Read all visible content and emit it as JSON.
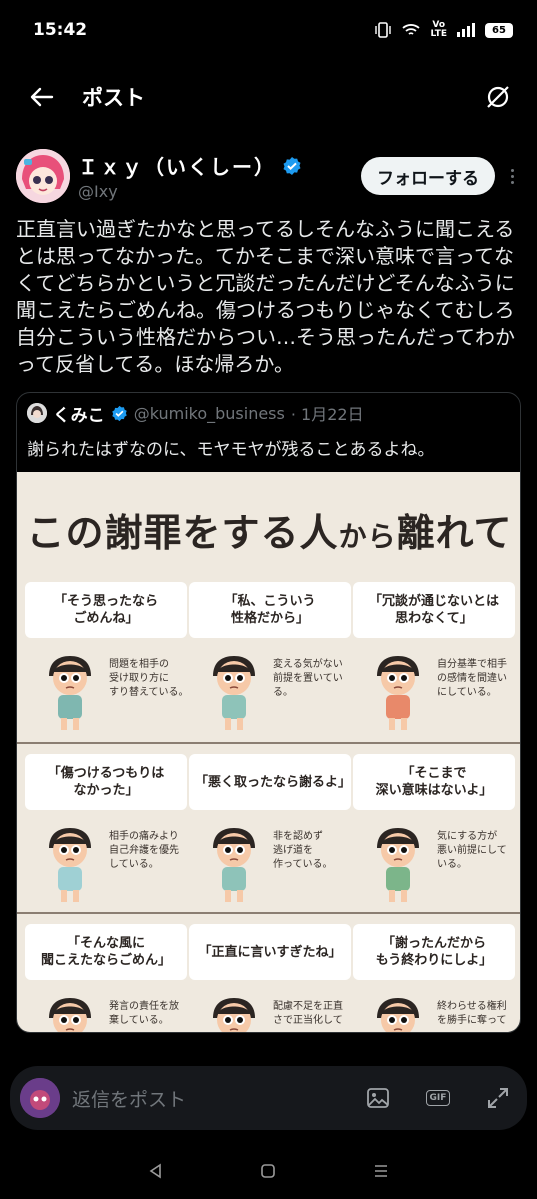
{
  "status_bar": {
    "time": "15:42",
    "volte_top": "Vo",
    "volte_bottom": "LTE",
    "battery": "65"
  },
  "header": {
    "title": "ポスト"
  },
  "post": {
    "author_name": "Ｉｘｙ（いくしー）",
    "author_handle": "@Ixy",
    "follow_label": "フォローする",
    "text": "正直言い過ぎたかなと思ってるしそんなふうに聞こえるとは思ってなかった。てかそこまで深い意味で言ってなくてどちらかというと冗談だったんだけどそんなふうに聞こえたらごめんね。傷つけるつもりじゃなくてむしろ自分こういう性格だからつい…そう思ったんだってわかって反省してる。ほな帰ろか。"
  },
  "quote": {
    "author_name": "くみこ",
    "author_handle": "@kumiko_business",
    "date": "· 1月22日",
    "text": "謝られたはずなのに、モヤモヤが残ることあるよね。",
    "infographic": {
      "title_main": "この謝罪をする人",
      "title_small": "から",
      "title_end": "離れて",
      "rows": [
        [
          {
            "quote": "「そう思ったなら\nごめんね」",
            "note": "問題を相手の\n受け取り方に\nすり替えている。",
            "shirt": "#7fb7b0"
          },
          {
            "quote": "「私、こういう\n性格だから」",
            "note": "変える気がない\n前提を置いてい\nる。",
            "shirt": "#8ec3b9"
          },
          {
            "quote": "「冗談が通じないとは\n思わなくて」",
            "note": "自分基準で相手\nの感情を間違い\nにしている。",
            "shirt": "#e8896a"
          }
        ],
        [
          {
            "quote": "「傷つけるつもりは\nなかった」",
            "note": "相手の痛みより\n自己弁護を優先\nしている。",
            "shirt": "#9fd0d4"
          },
          {
            "quote": "「悪く取ったなら謝るよ」",
            "note": "非を認めず\n逃げ道を\n作っている。",
            "shirt": "#8ec3b9"
          },
          {
            "quote": "「そこまで\n深い意味はないよ」",
            "note": "気にする方が\n悪い前提にして\nいる。",
            "shirt": "#7cb58a"
          }
        ],
        [
          {
            "quote": "「そんな風に\n聞こえたならごめん」",
            "note": "発言の責任を放\n棄している。",
            "shirt": "#e2a24a"
          },
          {
            "quote": "「正直に言いすぎたね」",
            "note": "配慮不足を正直\nさで正当化して",
            "shirt": "#b07a5a"
          },
          {
            "quote": "「謝ったんだから\nもう終わりにしよ」",
            "note": "終わらせる権利\nを勝手に奪って",
            "shirt": "#e2a24a"
          }
        ]
      ]
    }
  },
  "reply_bar": {
    "placeholder": "返信をポスト",
    "gif_label": "GIF"
  },
  "colors": {
    "background": "#000000",
    "verified": "#1d9bf0",
    "muted": "#71767b",
    "infographic_bg": "#efe9df"
  }
}
